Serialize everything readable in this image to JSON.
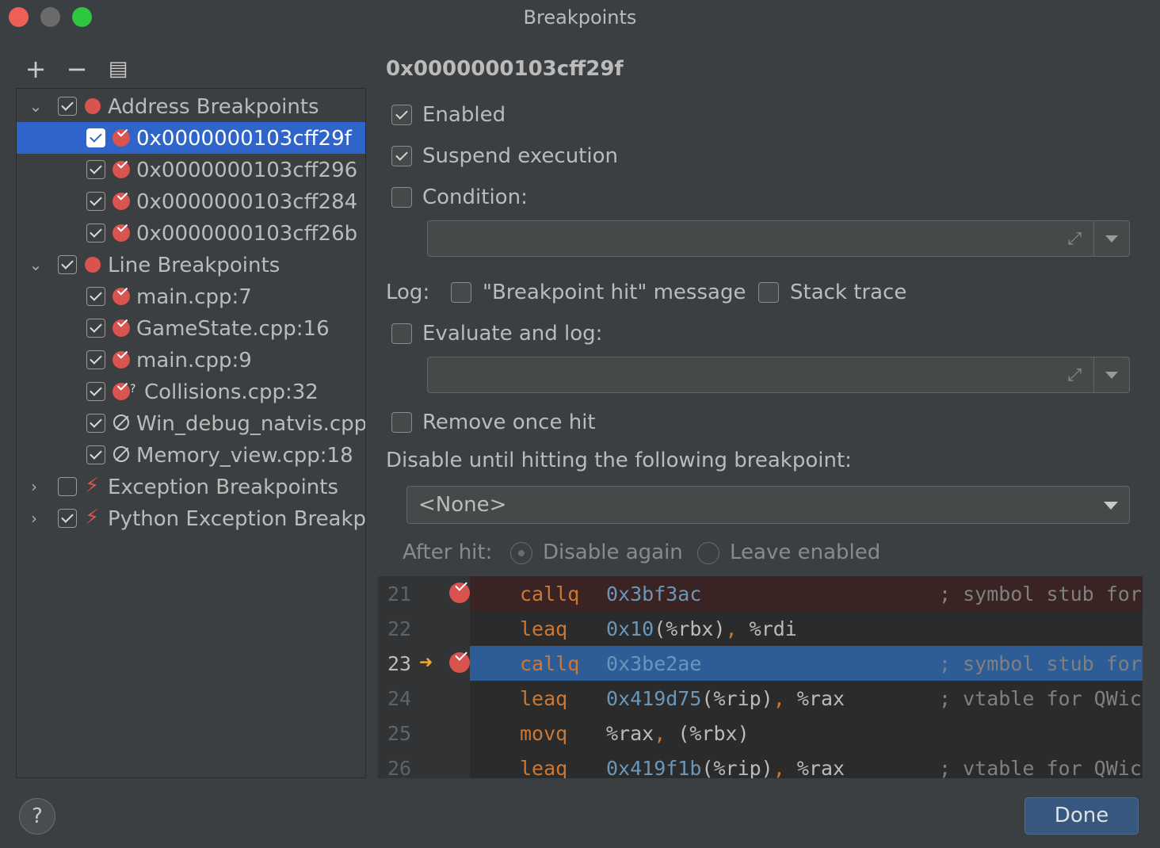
{
  "window": {
    "title": "Breakpoints"
  },
  "toolbar": {
    "add": "+",
    "remove": "−",
    "group": "▤"
  },
  "tree": {
    "groups": [
      {
        "label": "Address Breakpoints"
      },
      {
        "label": "Line Breakpoints"
      },
      {
        "label": "Exception Breakpoints"
      },
      {
        "label": "Python Exception Breakpc"
      }
    ],
    "items": [
      {
        "label": "0x0000000103cff29f"
      },
      {
        "label": "0x0000000103cff296"
      },
      {
        "label": "0x0000000103cff284"
      },
      {
        "label": "0x0000000103cff26b"
      },
      {
        "label": "main.cpp:7"
      },
      {
        "label": "GameState.cpp:16"
      },
      {
        "label": "main.cpp:9"
      },
      {
        "label": "Collisions.cpp:32"
      },
      {
        "label": "Win_debug_natvis.cpp:"
      },
      {
        "label": "Memory_view.cpp:18"
      }
    ]
  },
  "detail": {
    "title": "0x0000000103cff29f",
    "enabled": "Enabled",
    "suspend": "Suspend execution",
    "condition": "Condition:",
    "log": "Log:",
    "log_message": "\"Breakpoint hit\" message",
    "stack_trace": "Stack trace",
    "evaluate": "Evaluate and log:",
    "remove_once": "Remove once hit",
    "disable_until": "Disable until hitting the following breakpoint:",
    "disable_value": "<None>",
    "after_hit": "After hit:",
    "disable_again": "Disable again",
    "leave_enabled": "Leave enabled"
  },
  "code": {
    "lines": [
      {
        "n": "21",
        "op": "callq",
        "a1": "0x3bf3ac",
        "a2": "",
        "a3": "",
        "a4": "",
        "a5": "",
        "cmt": "; symbol stub for"
      },
      {
        "n": "22",
        "op": "leaq",
        "a1": "0x10",
        "a2": "(%rbx)",
        "a3": ",",
        "a4": " %rdi",
        "a5": "",
        "cmt": ""
      },
      {
        "n": "23",
        "op": "callq",
        "a1": "0x3be2ae",
        "a2": "",
        "a3": "",
        "a4": "",
        "a5": "",
        "cmt": "; symbol stub for"
      },
      {
        "n": "24",
        "op": "leaq",
        "a1": "0x419d75",
        "a2": "(%rip)",
        "a3": ",",
        "a4": " %rax",
        "a5": "",
        "cmt": "; vtable for QWic"
      },
      {
        "n": "25",
        "op": "movq",
        "a1": "",
        "a2": "%rax",
        "a3": ",",
        "a4": " (%rbx)",
        "a5": "",
        "cmt": ""
      },
      {
        "n": "26",
        "op": "leaq",
        "a1": "0x419f1b",
        "a2": "(%rip)",
        "a3": ",",
        "a4": " %rax",
        "a5": "",
        "cmt": "; vtable for QWic"
      }
    ]
  },
  "footer": {
    "help": "?",
    "done": "Done"
  },
  "colors": {
    "accent": "#2f65ca",
    "breakpoint": "#d9534f",
    "done_button": "#365880"
  }
}
